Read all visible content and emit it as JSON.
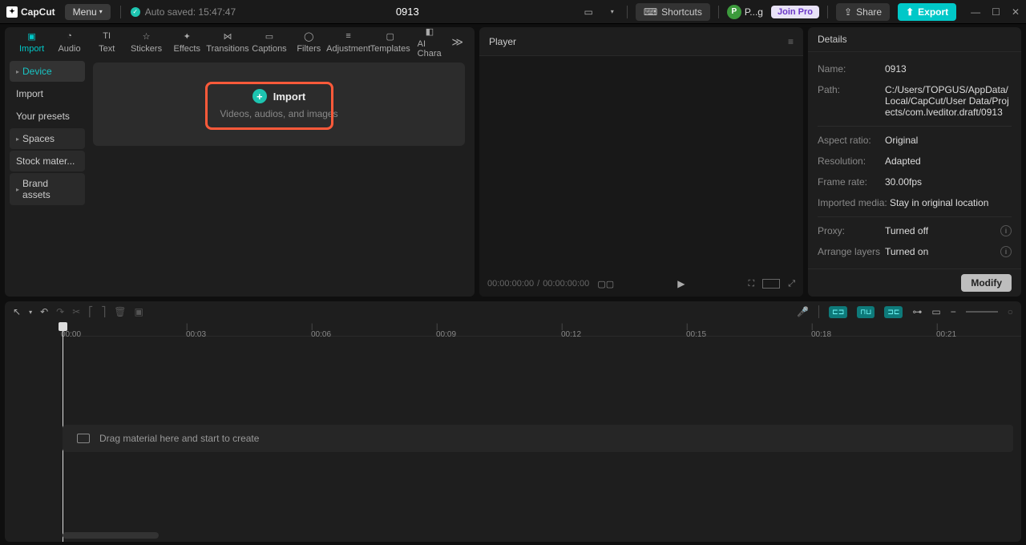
{
  "app": {
    "name": "CapCut",
    "project_title": "0913",
    "autosave": "Auto saved: 15:47:47"
  },
  "menu": {
    "label": "Menu"
  },
  "titlebar": {
    "shortcuts": "Shortcuts",
    "user_initial": "P",
    "user_name": "P...g",
    "join_pro": "Join Pro",
    "share": "Share",
    "export": "Export"
  },
  "tabs": [
    {
      "label": "Import",
      "icon": "import",
      "active": true
    },
    {
      "label": "Audio",
      "icon": "audio"
    },
    {
      "label": "Text",
      "icon": "text"
    },
    {
      "label": "Stickers",
      "icon": "stickers"
    },
    {
      "label": "Effects",
      "icon": "effects"
    },
    {
      "label": "Transitions",
      "icon": "transitions"
    },
    {
      "label": "Captions",
      "icon": "captions"
    },
    {
      "label": "Filters",
      "icon": "filters"
    },
    {
      "label": "Adjustment",
      "icon": "adjustment"
    },
    {
      "label": "Templates",
      "icon": "templates"
    },
    {
      "label": "AI Chara",
      "icon": "ai"
    }
  ],
  "sidebar": [
    {
      "label": "Device",
      "active": true,
      "caret": true
    },
    {
      "label": "Import"
    },
    {
      "label": "Your presets"
    },
    {
      "label": "Spaces",
      "block": true,
      "caret": true
    },
    {
      "label": "Stock mater...",
      "block": true
    },
    {
      "label": "Brand assets",
      "block": true,
      "caret": true
    }
  ],
  "import": {
    "title": "Import",
    "subtitle": "Videos, audios, and images"
  },
  "player": {
    "title": "Player",
    "time_current": "00:00:00:00",
    "time_total": "00:00:00:00"
  },
  "details": {
    "title": "Details",
    "rows": {
      "name": {
        "label": "Name:",
        "value": "0913"
      },
      "path": {
        "label": "Path:",
        "value": "C:/Users/TOPGUS/AppData/Local/CapCut/User Data/Projects/com.lveditor.draft/0913"
      },
      "aspect": {
        "label": "Aspect ratio:",
        "value": "Original"
      },
      "resolution": {
        "label": "Resolution:",
        "value": "Adapted"
      },
      "framerate": {
        "label": "Frame rate:",
        "value": "30.00fps"
      },
      "imported": {
        "label": "Imported media:",
        "value": "Stay in original location"
      },
      "proxy": {
        "label": "Proxy:",
        "value": "Turned off"
      },
      "arrange": {
        "label": "Arrange layers",
        "value": "Turned on"
      }
    },
    "modify": "Modify"
  },
  "timeline": {
    "ticks": [
      "00:00",
      "00:03",
      "00:06",
      "00:09",
      "00:12",
      "00:15",
      "00:18",
      "00:21"
    ],
    "drop_hint": "Drag material here and start to create"
  }
}
